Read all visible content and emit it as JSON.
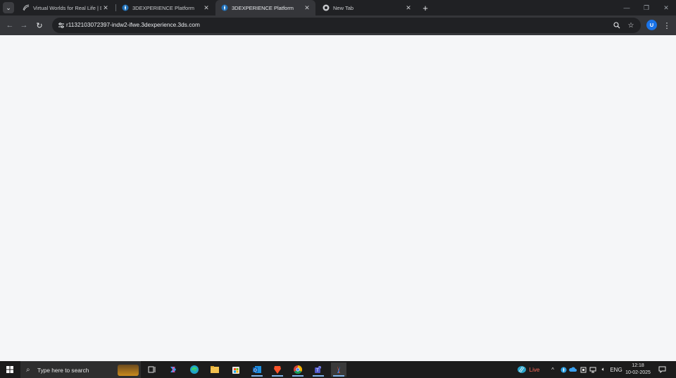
{
  "browser": {
    "tabs": [
      {
        "title": "Virtual Worlds for Real Life | Da",
        "favicon": "dassault-logo-icon",
        "active": false
      },
      {
        "title": "3DEXPERIENCE Platform",
        "favicon": "3dexperience-compass-icon",
        "active": false
      },
      {
        "title": "3DEXPERIENCE Platform",
        "favicon": "3dexperience-compass-icon",
        "active": true
      },
      {
        "title": "New Tab",
        "favicon": "chrome-icon",
        "active": false
      }
    ],
    "url": "r1132103072397-indw2-ifwe.3dexperience.3ds.com",
    "profile_initial": "U",
    "accent_color": "#1a73e8"
  },
  "taskbar": {
    "search_placeholder": "Type here to search",
    "apps": [
      "task-view-icon",
      "copilot-icon",
      "edge-icon",
      "file-explorer-icon",
      "microsoft-store-icon",
      "outlook-icon",
      "brave-icon",
      "chrome-icon",
      "teams-icon",
      "app-icon"
    ],
    "weather_label": "Live",
    "language": "ENG",
    "time": "12:18",
    "date": "10-02-2025"
  }
}
